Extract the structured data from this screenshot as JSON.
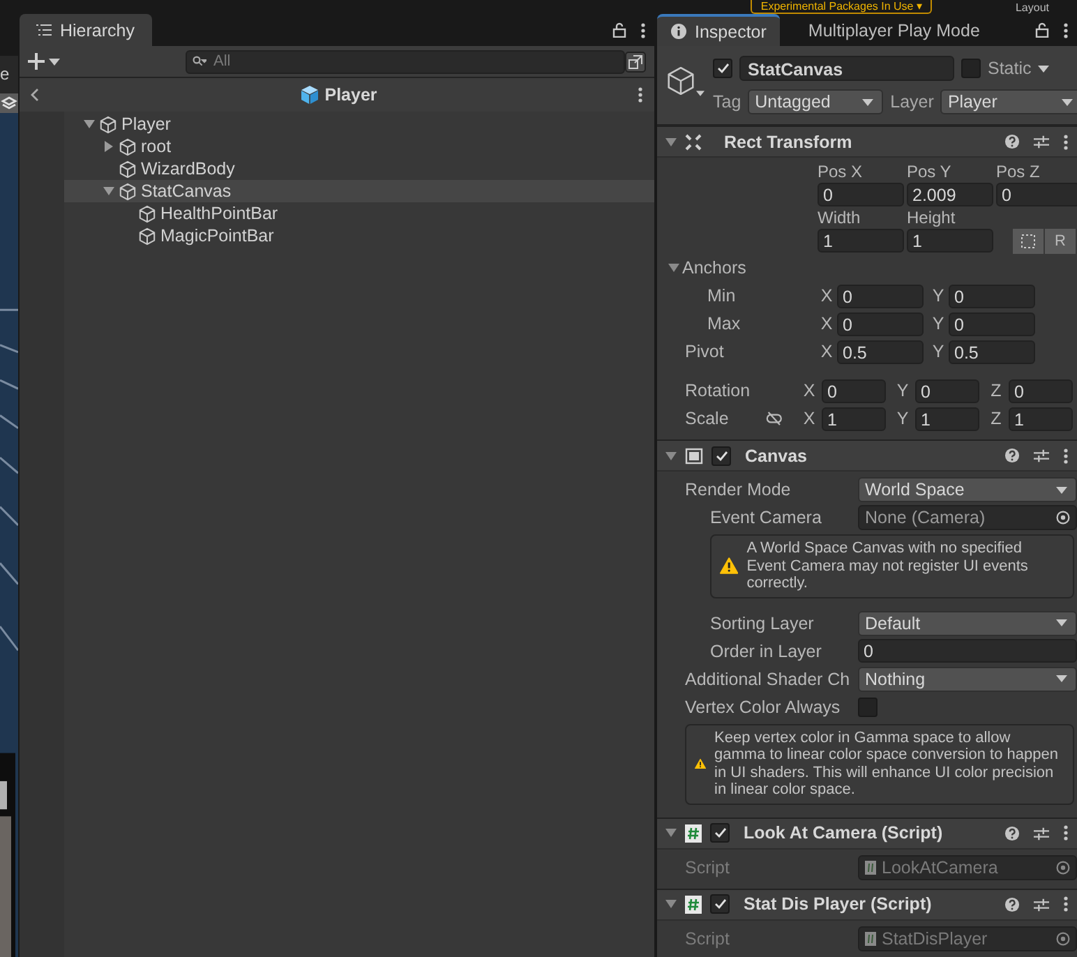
{
  "top_bar": {
    "notice": "Experimental Packages In Use ▾",
    "layout_button": "Layout"
  },
  "scene_strip": {
    "tab": "e"
  },
  "hierarchy": {
    "tab": "Hierarchy",
    "search": {
      "placeholder": "All"
    },
    "breadcrumb": "Player",
    "tree": [
      {
        "name": "Player",
        "selected": false,
        "expanded": true,
        "children": [
          {
            "name": "root",
            "selected": false,
            "expanded": false
          },
          {
            "name": "WizardBody",
            "selected": false
          },
          {
            "name": "StatCanvas",
            "selected": true,
            "expanded": true,
            "children": [
              {
                "name": "HealthPointBar",
                "selected": false
              },
              {
                "name": "MagicPointBar",
                "selected": false
              }
            ]
          }
        ]
      }
    ]
  },
  "inspector": {
    "tabs": [
      {
        "label": "Inspector",
        "selected": true
      },
      {
        "label": "Multiplayer Play Mode",
        "selected": false
      }
    ],
    "object": {
      "active": true,
      "name": "StatCanvas",
      "static": false,
      "static_label": "Static",
      "tag_label": "Tag",
      "tag": "Untagged",
      "layer_label": "Layer",
      "layer": "Player"
    },
    "components": [
      {
        "kind": "rect_transform",
        "title": "Rect Transform",
        "expanded": true,
        "position": {
          "labels": [
            "Pos X",
            "Pos Y",
            "Pos Z"
          ],
          "values": [
            "0",
            "2.009",
            "0"
          ]
        },
        "size": {
          "labels": [
            "Width",
            "Height"
          ],
          "values": [
            "1",
            "1"
          ],
          "raw_button": "R"
        },
        "anchors": {
          "label": "Anchors",
          "expanded": true,
          "rows": [
            {
              "label": "Min",
              "fields": [
                {
                  "axis": "X",
                  "value": "0"
                },
                {
                  "axis": "Y",
                  "value": "0"
                }
              ]
            },
            {
              "label": "Max",
              "fields": [
                {
                  "axis": "X",
                  "value": "0"
                },
                {
                  "axis": "Y",
                  "value": "0"
                }
              ]
            }
          ]
        },
        "pivot": {
          "label": "Pivot",
          "fields": [
            {
              "axis": "X",
              "value": "0.5"
            },
            {
              "axis": "Y",
              "value": "0.5"
            }
          ]
        },
        "rotation": {
          "label": "Rotation",
          "fields": [
            {
              "axis": "X",
              "value": "0"
            },
            {
              "axis": "Y",
              "value": "0"
            },
            {
              "axis": "Z",
              "value": "0"
            }
          ]
        },
        "scale": {
          "label": "Scale",
          "fields": [
            {
              "axis": "X",
              "value": "1"
            },
            {
              "axis": "Y",
              "value": "1"
            },
            {
              "axis": "Z",
              "value": "1"
            }
          ]
        }
      },
      {
        "kind": "canvas",
        "title": "Canvas",
        "expanded": true,
        "enabled": true,
        "rows": [
          {
            "kind": "dropdown",
            "label": "Render Mode",
            "value": "World Space",
            "indent": false
          },
          {
            "kind": "object",
            "label": "Event Camera",
            "value": "None (Camera)",
            "indent": true
          },
          {
            "kind": "warning",
            "text": "A World Space Canvas with no specified Event Camera may not register UI events correctly.",
            "indent": true
          },
          {
            "kind": "dropdown",
            "label": "Sorting Layer",
            "value": "Default",
            "indent": true
          },
          {
            "kind": "text",
            "label": "Order in Layer",
            "value": "0",
            "indent": true
          },
          {
            "kind": "dropdown",
            "label": "Additional Shader Ch",
            "value": "Nothing",
            "indent": false
          },
          {
            "kind": "checkbox",
            "label": "Vertex Color Always",
            "checked": false,
            "indent": false
          },
          {
            "kind": "warning",
            "text": "Keep vertex color in Gamma space to allow gamma to linear color space conversion to happen in UI shaders. This will enhance UI color precision in linear color space.",
            "indent": false
          }
        ]
      },
      {
        "kind": "script",
        "title": "Look At Camera (Script)",
        "expanded": true,
        "enabled": true,
        "rows": [
          {
            "kind": "script_ref",
            "label": "Script",
            "value": "LookAtCamera",
            "indent": false,
            "disabled": true
          }
        ]
      },
      {
        "kind": "script",
        "title": "Stat Dis Player (Script)",
        "expanded": true,
        "enabled": true,
        "rows": [
          {
            "kind": "script_ref",
            "label": "Script",
            "value": "StatDisPlayer",
            "indent": false,
            "disabled": true
          }
        ]
      }
    ]
  }
}
